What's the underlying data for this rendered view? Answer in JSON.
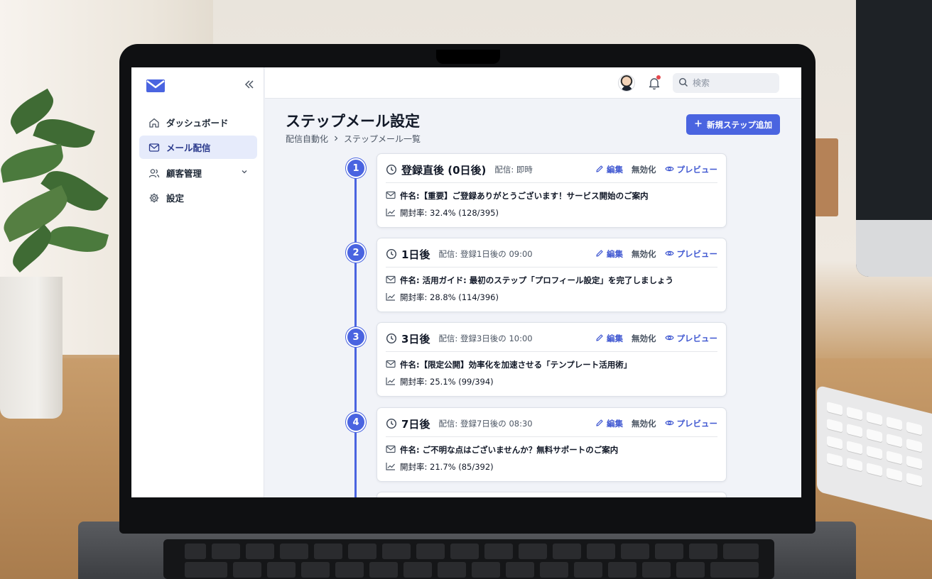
{
  "app": {
    "brand_icon": "mail-icon",
    "accent_color": "#4a64e0"
  },
  "sidebar": {
    "collapse_icon": "double-chevron-left-icon",
    "items": [
      {
        "label": "ダッシュボード",
        "icon": "home-icon",
        "active": false
      },
      {
        "label": "メール配信",
        "icon": "mail-icon",
        "active": true
      },
      {
        "label": "顧客管理",
        "icon": "users-icon",
        "active": false,
        "expandable": true
      },
      {
        "label": "設定",
        "icon": "gear-icon",
        "active": false
      }
    ]
  },
  "header": {
    "search_placeholder": "検索",
    "notification_dot": true
  },
  "page": {
    "title": "ステップメール設定",
    "breadcrumb": [
      "配信自動化",
      "ステップメール一覧"
    ],
    "add_button_label": "新規ステップ追加"
  },
  "steps": [
    {
      "number": "1",
      "timing": "登録直後 (0日後)",
      "schedule": "配信: 即時",
      "subject": "件名:【重要】ご登録ありがとうございます！サービス開始のご案内",
      "open_rate": "開封率: 32.4% (128/395)"
    },
    {
      "number": "2",
      "timing": "1日後",
      "schedule": "配信: 登録1日後の 09:00",
      "subject": "件名: 活用ガイド: 最初のステップ「プロフィール設定」を完了しましょう",
      "open_rate": "開封率: 28.8% (114/396)"
    },
    {
      "number": "3",
      "timing": "3日後",
      "schedule": "配信: 登録3日後の 10:00",
      "subject": "件名:【限定公開】効率化を加速させる「テンプレート活用術」",
      "open_rate": "開封率: 25.1% (99/394)"
    },
    {
      "number": "4",
      "timing": "7日後",
      "schedule": "配信: 登録7日後の 08:30",
      "subject": "件名: ご不明な点はございませんか？無料サポートのご案内",
      "open_rate": "開封率: 21.7% (85/392)"
    }
  ],
  "actions": {
    "edit": "編集",
    "disable": "無効化",
    "preview": "プレビュー"
  }
}
